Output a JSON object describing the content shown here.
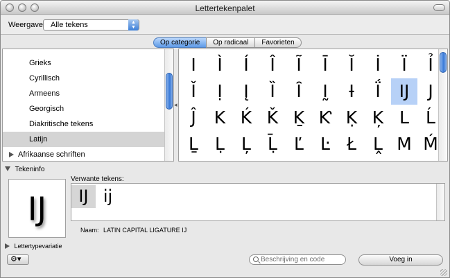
{
  "window": {
    "title": "Lettertekenpalet"
  },
  "toolbar": {
    "view_label": "Weergave:",
    "view_value": "Alle tekens"
  },
  "tabs": [
    {
      "label": "Op categorie",
      "active": true
    },
    {
      "label": "Op radicaal",
      "active": false
    },
    {
      "label": "Favorieten",
      "active": false
    }
  ],
  "categories": {
    "items": [
      {
        "label": "Grieks",
        "selected": false
      },
      {
        "label": "Cyrillisch",
        "selected": false
      },
      {
        "label": "Armeens",
        "selected": false
      },
      {
        "label": "Georgisch",
        "selected": false
      },
      {
        "label": "Diakritische tekens",
        "selected": false
      },
      {
        "label": "Latijn",
        "selected": true
      }
    ],
    "group": "Afrikaanse schriften"
  },
  "characters": [
    [
      "I",
      "Ì",
      "Í",
      "Î",
      "Ĩ",
      "Ī",
      "Ĭ",
      "İ",
      "Ï",
      "Ỉ"
    ],
    [
      "Ǐ",
      "Ị",
      "Į",
      "Ȉ",
      "Ȋ",
      "Ḭ",
      "Ɨ",
      "Ḯ",
      "Ĳ",
      "J"
    ],
    [
      "Ĵ",
      "K",
      "Ḱ",
      "Ǩ",
      "Ḵ",
      "Ƙ",
      "Ḳ",
      "Ķ",
      "L",
      "Ĺ"
    ],
    [
      "Ḻ",
      "Ḷ",
      "Ļ",
      "Ḹ",
      "Ľ",
      "Ŀ",
      "Ł",
      "Ḽ",
      "M",
      "Ḿ"
    ]
  ],
  "selected_char": "Ĳ",
  "info": {
    "header": "Tekeninfo",
    "preview": "Ĳ",
    "related_label": "Verwante tekens:",
    "related": [
      "Ĳ",
      "ĳ"
    ],
    "name_label": "Naam:",
    "name_value": "LATIN CAPITAL LIGATURE IJ"
  },
  "variation": {
    "label": "Lettertypevariatie"
  },
  "bottom": {
    "search_placeholder": "Beschrijving en code",
    "insert_label": "Voeg in",
    "gear": "⚙▾"
  },
  "icons": {
    "close": "traffic-button-icon",
    "gear": "gear-icon",
    "search": "search-icon",
    "zoom": "toolbar-toggle-icon"
  }
}
